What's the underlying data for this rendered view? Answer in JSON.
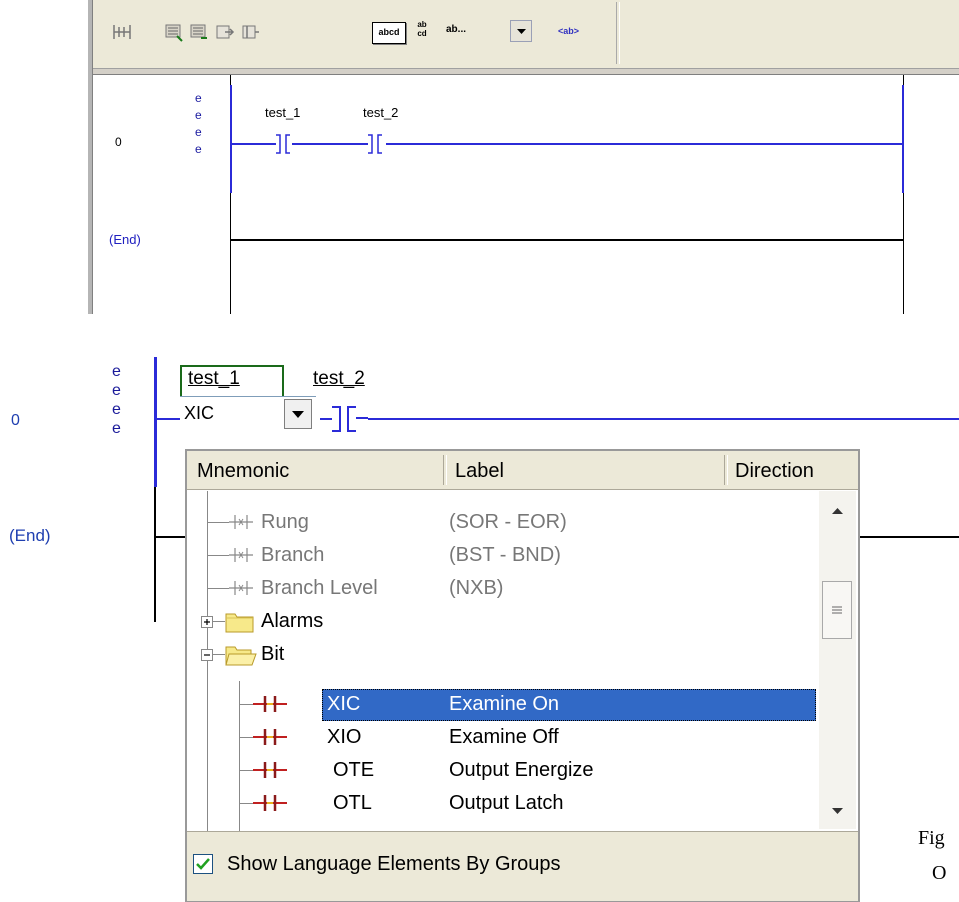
{
  "toolbar": {
    "text_button_label": "abcd",
    "stack_top": "ab",
    "stack_bottom": "cd",
    "combo_text": "ab...",
    "tag_button_label": "<ab>",
    "icons": [
      "rung-insert-icon",
      "branch-icon",
      "branch-level-icon",
      "instruction-icon",
      "instruction-right-icon"
    ]
  },
  "top_ladder": {
    "rung_number": "0",
    "end_label": "(End)",
    "e_marks": [
      "e",
      "e",
      "e",
      "e"
    ],
    "contact_1_tag": "test_1",
    "contact_2_tag": "test_2"
  },
  "zoom_ladder": {
    "rung_number": "0",
    "end_label": "(End)",
    "e_marks": [
      "e",
      "e",
      "e",
      "e"
    ],
    "contact_1_tag": "test_1",
    "contact_2_tag": "test_2",
    "editor_value": "XIC"
  },
  "popup": {
    "headers": {
      "mnemonic": "Mnemonic",
      "label": "Label",
      "direction": "Direction"
    },
    "rows": [
      {
        "mnemonic": "Rung",
        "label": "(SOR - EOR)",
        "style": "element"
      },
      {
        "mnemonic": "Branch",
        "label": "(BST - BND)",
        "style": "element"
      },
      {
        "mnemonic": "Branch Level",
        "label": "(NXB)",
        "style": "element"
      },
      {
        "mnemonic": "Alarms",
        "label": "",
        "style": "folder-closed"
      },
      {
        "mnemonic": "Bit",
        "label": "",
        "style": "folder-open"
      },
      {
        "mnemonic": "XIC",
        "label": "Examine On",
        "style": "instruction",
        "selected": true
      },
      {
        "mnemonic": "XIO",
        "label": "Examine Off",
        "style": "instruction"
      },
      {
        "mnemonic": "OTE",
        "label": "Output Energize",
        "style": "instruction"
      },
      {
        "mnemonic": "OTL",
        "label": "Output Latch",
        "style": "instruction"
      }
    ],
    "checkbox_label": "Show Language Elements By Groups",
    "checkbox_checked": true
  },
  "caption": {
    "line1": "Fig",
    "line2": "O"
  },
  "colors": {
    "rail_blue": "#2b2bd8",
    "selection": "#3169c6",
    "highlight_green": "#1a6a1a"
  }
}
